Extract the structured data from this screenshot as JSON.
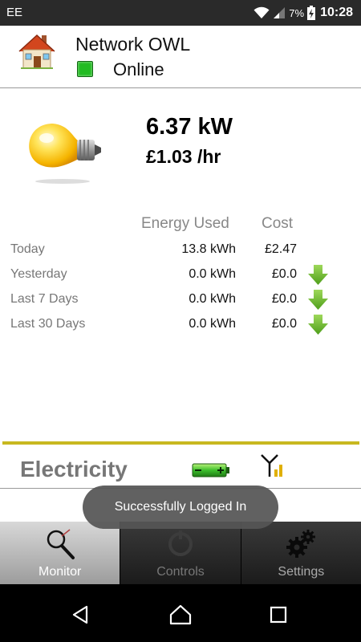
{
  "statusbar": {
    "carrier": "EE",
    "battery_pct": "7%",
    "time": "10:28",
    "icons": [
      "wifi-icon",
      "cell-signal-icon",
      "battery-charging-icon"
    ]
  },
  "header": {
    "device_name": "Network OWL",
    "connection_status": "Online",
    "status_color": "#22bb22",
    "icon": "house-icon"
  },
  "reading": {
    "power": "6.37 kW",
    "rate": "£1.03 /hr",
    "icon": "lightbulb-icon"
  },
  "table": {
    "headers": {
      "energy": "Energy Used",
      "cost": "Cost"
    },
    "rows": [
      {
        "label": "Today",
        "energy": "13.8 kWh",
        "cost": "£2.47",
        "trend": ""
      },
      {
        "label": "Yesterday",
        "energy": "0.0 kWh",
        "cost": "£0.0",
        "trend": "down-arrow-icon"
      },
      {
        "label": "Last 7 Days",
        "energy": "0.0 kWh",
        "cost": "£0.0",
        "trend": "down-arrow-icon"
      },
      {
        "label": "Last 30 Days",
        "energy": "0.0 kWh",
        "cost": "£0.0",
        "trend": "down-arrow-icon"
      }
    ]
  },
  "sensor": {
    "label": "Electricity",
    "battery_icon": "battery-full-icon",
    "signal_icon": "radio-signal-icon",
    "accent": "#c8b820"
  },
  "toast": {
    "text": "Successfully Logged In"
  },
  "tabs": [
    {
      "label": "Monitor",
      "icon": "magnifier-icon",
      "active": true
    },
    {
      "label": "Controls",
      "icon": "controls-icon",
      "active": false
    },
    {
      "label": "Settings",
      "icon": "gears-icon",
      "active": false
    }
  ],
  "navbar": {
    "buttons": [
      "back-icon",
      "home-icon",
      "recents-icon"
    ]
  }
}
